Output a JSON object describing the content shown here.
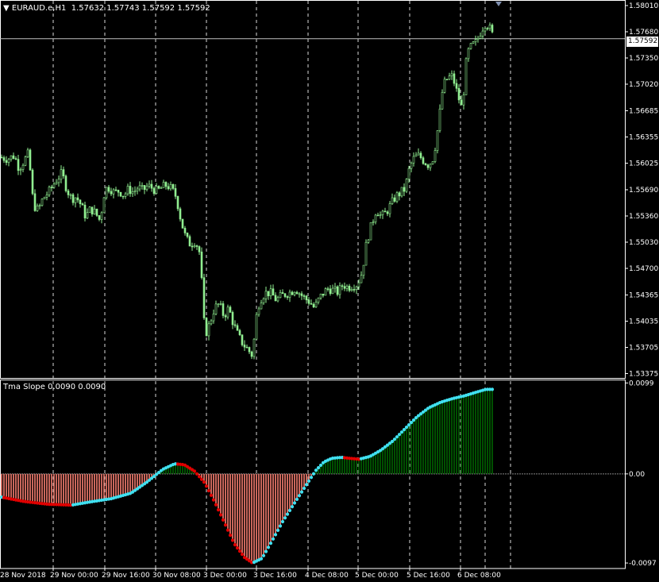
{
  "header": {
    "symbol": "EURAUD.e",
    "timeframe": "H1",
    "open": "1.57632",
    "high": "1.57743",
    "low": "1.57592",
    "close": "1.57592"
  },
  "indicator": {
    "name": "Tma Slope",
    "value1": "0.0090",
    "value2": "0.0090"
  },
  "colors": {
    "background": "#000000",
    "candle": "#90EE90",
    "grid": "#FFFFFF",
    "bid_line": "#C0C0C0",
    "hist_positive": "#006400",
    "hist_negative": "#FA8072",
    "dot_up": "#40E0F0",
    "dot_down": "#E00000"
  },
  "chart_data": [
    {
      "type": "candlestick",
      "title": "EURAUD.e,H1",
      "x_ticks": [
        "28 Nov 2018",
        "29 Nov 00:00",
        "29 Nov 16:00",
        "30 Nov 08:00",
        "3 Dec 00:00",
        "3 Dec 16:00",
        "4 Dec 08:00",
        "5 Dec 00:00",
        "5 Dec 16:00",
        "6 Dec 08:00"
      ],
      "y_ticks": [
        "1.58010",
        "1.57680",
        "1.57350",
        "1.57020",
        "1.56685",
        "1.56355",
        "1.56025",
        "1.55690",
        "1.55360",
        "1.55030",
        "1.54700",
        "1.54365",
        "1.54035",
        "1.53705",
        "1.53375"
      ],
      "ylim": [
        1.5332,
        1.5806
      ],
      "current_price": "1.57592",
      "close_path": [
        [
          0,
          1.561
        ],
        [
          10,
          1.5608
        ],
        [
          18,
          1.5612
        ],
        [
          24,
          1.5596
        ],
        [
          30,
          1.5605
        ],
        [
          36,
          1.5615
        ],
        [
          42,
          1.555
        ],
        [
          48,
          1.5543
        ],
        [
          54,
          1.5558
        ],
        [
          62,
          1.5567
        ],
        [
          70,
          1.558
        ],
        [
          78,
          1.559
        ],
        [
          84,
          1.557
        ],
        [
          90,
          1.5558
        ],
        [
          96,
          1.556
        ],
        [
          102,
          1.555
        ],
        [
          108,
          1.5535
        ],
        [
          114,
          1.5545
        ],
        [
          120,
          1.554
        ],
        [
          126,
          1.553
        ],
        [
          132,
          1.557
        ],
        [
          138,
          1.5572
        ],
        [
          144,
          1.5565
        ],
        [
          150,
          1.5568
        ],
        [
          156,
          1.5562
        ],
        [
          162,
          1.557
        ],
        [
          168,
          1.5566
        ],
        [
          174,
          1.5572
        ],
        [
          180,
          1.5568
        ],
        [
          186,
          1.5574
        ],
        [
          192,
          1.5571
        ],
        [
          198,
          1.5567
        ],
        [
          204,
          1.5572
        ],
        [
          210,
          1.5575
        ],
        [
          216,
          1.557
        ],
        [
          222,
          1.556
        ],
        [
          228,
          1.553
        ],
        [
          234,
          1.5508
        ],
        [
          240,
          1.55
        ],
        [
          246,
          1.5505
        ],
        [
          252,
          1.5488
        ],
        [
          258,
          1.5385
        ],
        [
          264,
          1.54
        ],
        [
          270,
          1.542
        ],
        [
          276,
          1.5425
        ],
        [
          282,
          1.541
        ],
        [
          288,
          1.542
        ],
        [
          294,
          1.54
        ],
        [
          300,
          1.5385
        ],
        [
          306,
          1.5375
        ],
        [
          312,
          1.5368
        ],
        [
          318,
          1.536
        ],
        [
          324,
          1.542
        ],
        [
          330,
          1.5435
        ],
        [
          336,
          1.544
        ],
        [
          342,
          1.5438
        ],
        [
          348,
          1.543
        ],
        [
          354,
          1.5435
        ],
        [
          360,
          1.5438
        ],
        [
          366,
          1.544
        ],
        [
          372,
          1.5445
        ],
        [
          378,
          1.5438
        ],
        [
          384,
          1.5432
        ],
        [
          390,
          1.5428
        ],
        [
          396,
          1.542
        ],
        [
          402,
          1.5432
        ],
        [
          408,
          1.544
        ],
        [
          414,
          1.5445
        ],
        [
          420,
          1.5442
        ],
        [
          426,
          1.544
        ],
        [
          432,
          1.545
        ],
        [
          438,
          1.5446
        ],
        [
          444,
          1.5449
        ],
        [
          450,
          1.545
        ],
        [
          456,
          1.5465
        ],
        [
          462,
          1.5505
        ],
        [
          468,
          1.5525
        ],
        [
          474,
          1.5545
        ],
        [
          480,
          1.5535
        ],
        [
          486,
          1.554
        ],
        [
          492,
          1.555
        ],
        [
          498,
          1.556
        ],
        [
          504,
          1.5565
        ],
        [
          510,
          1.557
        ],
        [
          516,
          1.5598
        ],
        [
          522,
          1.561
        ],
        [
          528,
          1.5612
        ],
        [
          534,
          1.5605
        ],
        [
          540,
          1.56
        ],
        [
          546,
          1.561
        ],
        [
          552,
          1.565
        ],
        [
          558,
          1.57
        ],
        [
          564,
          1.571
        ],
        [
          570,
          1.5712
        ],
        [
          576,
          1.569
        ],
        [
          582,
          1.567
        ],
        [
          588,
          1.574
        ],
        [
          594,
          1.575
        ],
        [
          600,
          1.5755
        ],
        [
          606,
          1.577
        ],
        [
          612,
          1.578
        ],
        [
          618,
          1.577
        ],
        [
          622,
          1.57592
        ]
      ]
    },
    {
      "type": "bar",
      "title": "Tma Slope 0.0090 0.0090",
      "y_ticks": [
        "0.0099",
        "0.00",
        "-0.0097"
      ],
      "ylim": [
        -0.0103,
        0.0101
      ],
      "slope_path": [
        [
          0,
          -0.0025
        ],
        [
          30,
          -0.003
        ],
        [
          60,
          -0.0033
        ],
        [
          90,
          -0.0034
        ],
        [
          110,
          -0.0031
        ],
        [
          140,
          -0.0027
        ],
        [
          165,
          -0.0021
        ],
        [
          185,
          -0.0009
        ],
        [
          205,
          0.0005
        ],
        [
          220,
          0.0011
        ],
        [
          232,
          0.001
        ],
        [
          245,
          0.0003
        ],
        [
          258,
          -0.001
        ],
        [
          270,
          -0.003
        ],
        [
          282,
          -0.0052
        ],
        [
          295,
          -0.0076
        ],
        [
          308,
          -0.0091
        ],
        [
          318,
          -0.0097
        ],
        [
          330,
          -0.0092
        ],
        [
          342,
          -0.0074
        ],
        [
          356,
          -0.0052
        ],
        [
          370,
          -0.0033
        ],
        [
          385,
          -0.0013
        ],
        [
          398,
          0.0004
        ],
        [
          408,
          0.0013
        ],
        [
          418,
          0.0017
        ],
        [
          430,
          0.0018
        ],
        [
          440,
          0.0017
        ],
        [
          452,
          0.0016
        ],
        [
          466,
          0.0019
        ],
        [
          480,
          0.0026
        ],
        [
          495,
          0.0036
        ],
        [
          510,
          0.0049
        ],
        [
          525,
          0.0062
        ],
        [
          540,
          0.0072
        ],
        [
          555,
          0.0078
        ],
        [
          570,
          0.0082
        ],
        [
          585,
          0.0085
        ],
        [
          600,
          0.0089
        ],
        [
          612,
          0.0092
        ],
        [
          622,
          0.0092
        ]
      ]
    }
  ]
}
